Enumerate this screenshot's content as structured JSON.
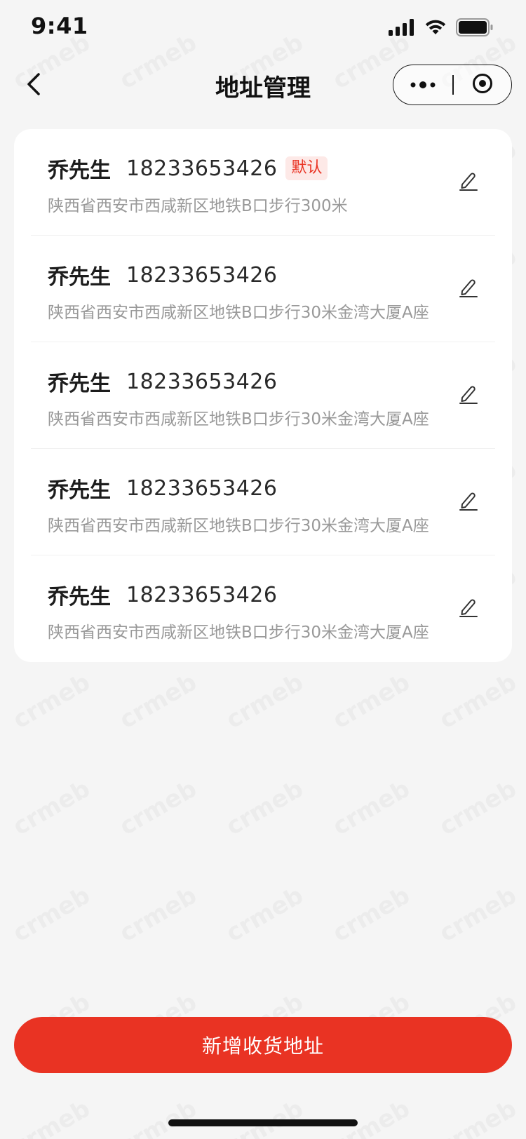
{
  "status_bar": {
    "time": "9:41"
  },
  "nav": {
    "title": "地址管理",
    "back_icon": "chevron-left-icon",
    "more_icon": "more-dots-icon",
    "close_icon": "target-close-icon"
  },
  "addresses": [
    {
      "name": "乔先生",
      "phone": "18233653426",
      "default_tag": "默认",
      "detail": "陕西省西安市西咸新区地铁B口步行300米"
    },
    {
      "name": "乔先生",
      "phone": "18233653426",
      "default_tag": "",
      "detail": "陕西省西安市西咸新区地铁B口步行30米金湾大厦A座"
    },
    {
      "name": "乔先生",
      "phone": "18233653426",
      "default_tag": "",
      "detail": "陕西省西安市西咸新区地铁B口步行30米金湾大厦A座"
    },
    {
      "name": "乔先生",
      "phone": "18233653426",
      "default_tag": "",
      "detail": "陕西省西安市西咸新区地铁B口步行30米金湾大厦A座"
    },
    {
      "name": "乔先生",
      "phone": "18233653426",
      "default_tag": "",
      "detail": "陕西省西安市西咸新区地铁B口步行30米金湾大厦A座"
    }
  ],
  "footer": {
    "add_button_label": "新增收货地址"
  },
  "colors": {
    "accent": "#e93323",
    "default_tag_bg": "#fde9e7",
    "page_bg": "#f5f5f5",
    "card_bg": "#ffffff",
    "detail_text": "#999999"
  },
  "watermark": {
    "text": "crmeb"
  }
}
